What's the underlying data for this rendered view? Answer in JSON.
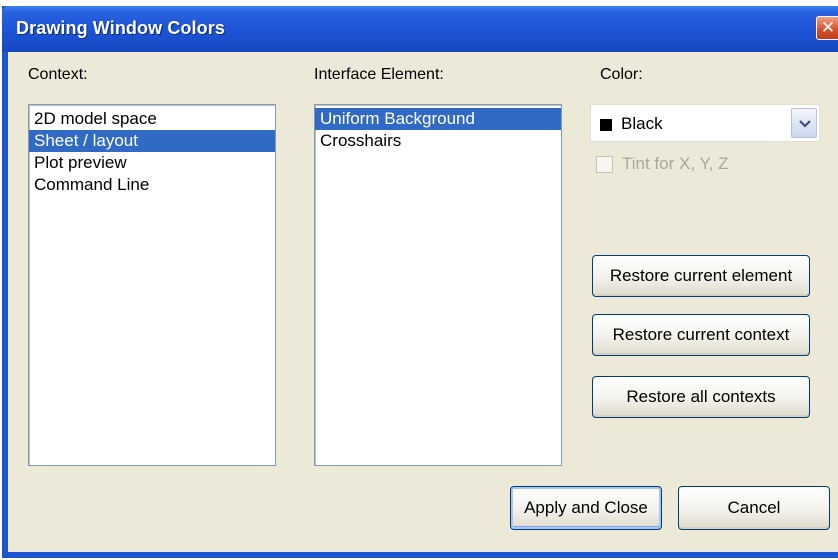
{
  "window": {
    "title": "Drawing Window Colors",
    "close_glyph": "✕",
    "icons": {
      "close": "close-icon",
      "dropdown": "chevron-down-icon"
    }
  },
  "context": {
    "label": "Context:",
    "items": [
      "2D model space",
      "Sheet / layout",
      "Plot preview",
      "Command Line"
    ],
    "selected": "Sheet / layout"
  },
  "interface_element": {
    "label": "Interface Element:",
    "items": [
      "Uniform Background",
      "Crosshairs"
    ],
    "selected": "Uniform Background"
  },
  "color": {
    "label": "Color:",
    "value": "Black",
    "swatch": "#000000"
  },
  "tint": {
    "label": "Tint for X, Y, Z",
    "checked": false,
    "disabled": true
  },
  "buttons": {
    "restore_element": "Restore current element",
    "restore_context": "Restore current context",
    "restore_all": "Restore all contexts",
    "apply_close": "Apply and Close",
    "cancel": "Cancel"
  },
  "colors": {
    "titlebar": "#1f57d8",
    "selection": "#316ac5",
    "dialog_bg": "#ece9d8"
  }
}
